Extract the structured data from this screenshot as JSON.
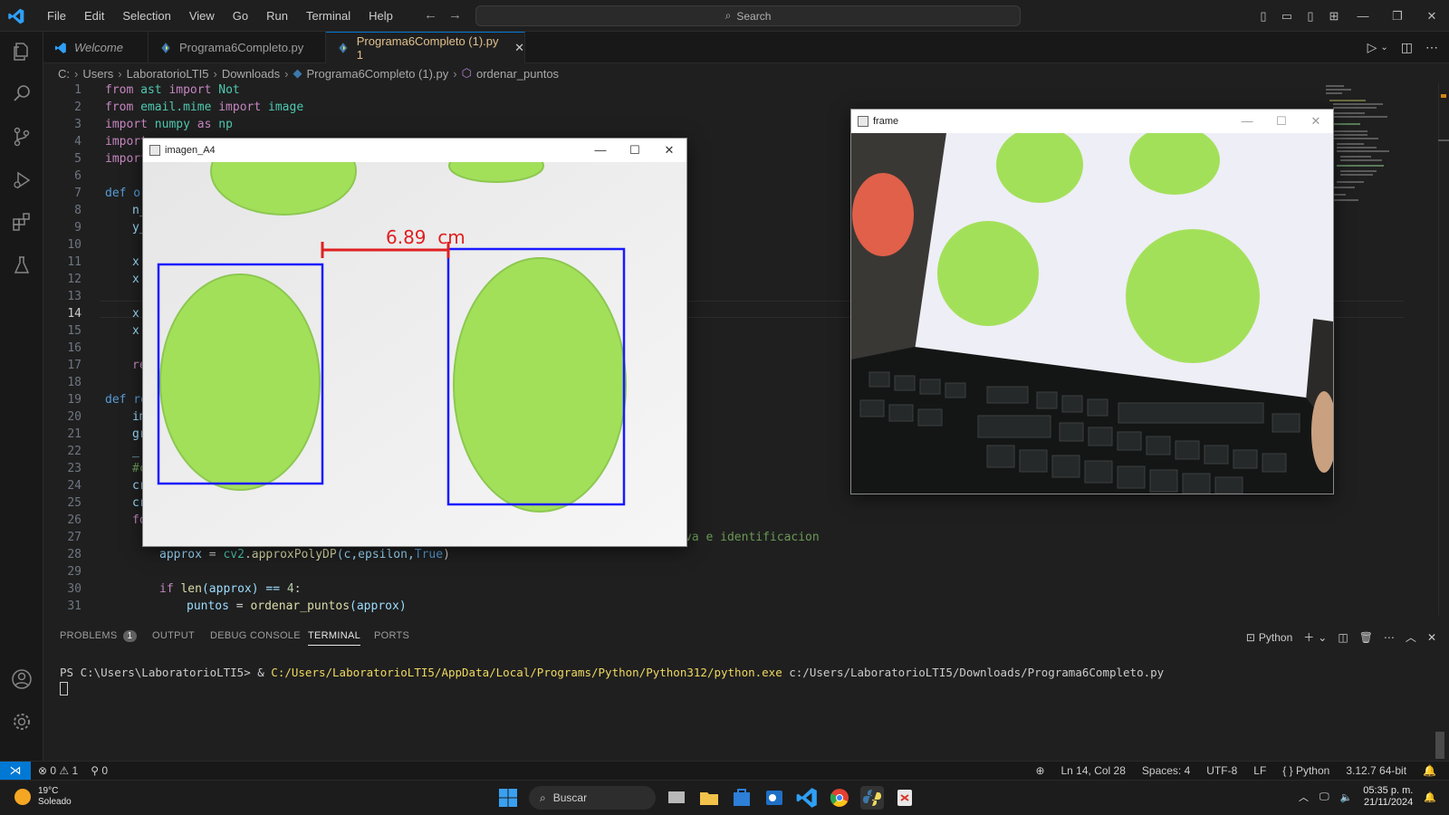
{
  "menu": [
    "File",
    "Edit",
    "Selection",
    "View",
    "Go",
    "Run",
    "Terminal",
    "Help"
  ],
  "search_placeholder": "Search",
  "tabs": [
    {
      "label": "Welcome"
    },
    {
      "label": "Programa6Completo.py"
    },
    {
      "label": "Programa6Completo (1).py 1"
    }
  ],
  "breadcrumb": [
    "C:",
    "Users",
    "LaboratorioLTI5",
    "Downloads",
    "Programa6Completo (1).py",
    "ordenar_puntos"
  ],
  "code_lines": {
    "l1": [
      "from",
      " ast ",
      "import",
      " Not"
    ],
    "l2": [
      "from",
      " email.mime ",
      "import",
      " image"
    ],
    "l3": [
      "import",
      " numpy ",
      "as",
      " np"
    ],
    "l4": "import",
    "l5": "import",
    "l7": "def or",
    "l8": "n_",
    "l9": "y_",
    "l11": "x",
    "l12": "x",
    "l14": "x",
    "l15": "x",
    "l17": "re",
    "l19": "def ro",
    "l20": "im",
    "l21": "gr",
    "l22": "_",
    "l23": "#c",
    "l24": "cr",
    "l25": "cr",
    "l26": "fo",
    "l27_tail": "va e identificacion",
    "l28": [
      "approx",
      " = ",
      "cv2",
      ".",
      "approxPolyDP",
      "(c,epsilon,",
      "True",
      ")"
    ],
    "l30": [
      "if",
      " ",
      "len",
      "(approx) == ",
      "4",
      ":"
    ],
    "l31": [
      "puntos",
      " = ",
      "ordenar_puntos",
      "(approx)"
    ]
  },
  "windows": {
    "imagen": {
      "title": "imagen_A4",
      "measure": "6.89  cm"
    },
    "frame": {
      "title": "frame"
    }
  },
  "panel": {
    "tabs": [
      "PROBLEMS",
      "OUTPUT",
      "DEBUG CONSOLE",
      "TERMINAL",
      "PORTS"
    ],
    "problems_count": "1",
    "shell": "Python",
    "prompt": "PS C:\\Users\\LaboratorioLTI5> & ",
    "exe": "C:/Users/LaboratorioLTI5/AppData/Local/Programs/Python/Python312/python.exe",
    "arg": " c:/Users/LaboratorioLTI5/Downloads/Programa6Completo.py"
  },
  "status": {
    "errors": "0",
    "warnings": "1",
    "ports": "0",
    "position": "Ln 14, Col 28",
    "spaces": "Spaces: 4",
    "encoding": "UTF-8",
    "eol": "LF",
    "language": "Python",
    "interpreter": "3.12.7 64-bit"
  },
  "taskbar": {
    "temp": "19°C",
    "weather": "Soleado",
    "search": "Buscar",
    "time": "05:35 p. m.",
    "date": "21/11/2024"
  },
  "colors": {
    "accent": "#0078d4",
    "tab_modified": "#e2c08d",
    "green_shape": "#a3e05a",
    "box_blue": "#1a1aff",
    "measure_red": "#e02020"
  }
}
